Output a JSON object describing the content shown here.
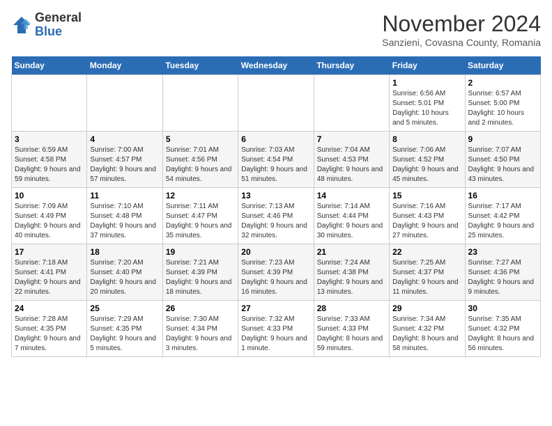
{
  "logo": {
    "text_general": "General",
    "text_blue": "Blue"
  },
  "header": {
    "title": "November 2024",
    "subtitle": "Sanzieni, Covasna County, Romania"
  },
  "weekdays": [
    "Sunday",
    "Monday",
    "Tuesday",
    "Wednesday",
    "Thursday",
    "Friday",
    "Saturday"
  ],
  "weeks": [
    [
      {
        "day": "",
        "sunrise": "",
        "sunset": "",
        "daylight": ""
      },
      {
        "day": "",
        "sunrise": "",
        "sunset": "",
        "daylight": ""
      },
      {
        "day": "",
        "sunrise": "",
        "sunset": "",
        "daylight": ""
      },
      {
        "day": "",
        "sunrise": "",
        "sunset": "",
        "daylight": ""
      },
      {
        "day": "",
        "sunrise": "",
        "sunset": "",
        "daylight": ""
      },
      {
        "day": "1",
        "sunrise": "Sunrise: 6:56 AM",
        "sunset": "Sunset: 5:01 PM",
        "daylight": "Daylight: 10 hours and 5 minutes."
      },
      {
        "day": "2",
        "sunrise": "Sunrise: 6:57 AM",
        "sunset": "Sunset: 5:00 PM",
        "daylight": "Daylight: 10 hours and 2 minutes."
      }
    ],
    [
      {
        "day": "3",
        "sunrise": "Sunrise: 6:59 AM",
        "sunset": "Sunset: 4:58 PM",
        "daylight": "Daylight: 9 hours and 59 minutes."
      },
      {
        "day": "4",
        "sunrise": "Sunrise: 7:00 AM",
        "sunset": "Sunset: 4:57 PM",
        "daylight": "Daylight: 9 hours and 57 minutes."
      },
      {
        "day": "5",
        "sunrise": "Sunrise: 7:01 AM",
        "sunset": "Sunset: 4:56 PM",
        "daylight": "Daylight: 9 hours and 54 minutes."
      },
      {
        "day": "6",
        "sunrise": "Sunrise: 7:03 AM",
        "sunset": "Sunset: 4:54 PM",
        "daylight": "Daylight: 9 hours and 51 minutes."
      },
      {
        "day": "7",
        "sunrise": "Sunrise: 7:04 AM",
        "sunset": "Sunset: 4:53 PM",
        "daylight": "Daylight: 9 hours and 48 minutes."
      },
      {
        "day": "8",
        "sunrise": "Sunrise: 7:06 AM",
        "sunset": "Sunset: 4:52 PM",
        "daylight": "Daylight: 9 hours and 45 minutes."
      },
      {
        "day": "9",
        "sunrise": "Sunrise: 7:07 AM",
        "sunset": "Sunset: 4:50 PM",
        "daylight": "Daylight: 9 hours and 43 minutes."
      }
    ],
    [
      {
        "day": "10",
        "sunrise": "Sunrise: 7:09 AM",
        "sunset": "Sunset: 4:49 PM",
        "daylight": "Daylight: 9 hours and 40 minutes."
      },
      {
        "day": "11",
        "sunrise": "Sunrise: 7:10 AM",
        "sunset": "Sunset: 4:48 PM",
        "daylight": "Daylight: 9 hours and 37 minutes."
      },
      {
        "day": "12",
        "sunrise": "Sunrise: 7:11 AM",
        "sunset": "Sunset: 4:47 PM",
        "daylight": "Daylight: 9 hours and 35 minutes."
      },
      {
        "day": "13",
        "sunrise": "Sunrise: 7:13 AM",
        "sunset": "Sunset: 4:46 PM",
        "daylight": "Daylight: 9 hours and 32 minutes."
      },
      {
        "day": "14",
        "sunrise": "Sunrise: 7:14 AM",
        "sunset": "Sunset: 4:44 PM",
        "daylight": "Daylight: 9 hours and 30 minutes."
      },
      {
        "day": "15",
        "sunrise": "Sunrise: 7:16 AM",
        "sunset": "Sunset: 4:43 PM",
        "daylight": "Daylight: 9 hours and 27 minutes."
      },
      {
        "day": "16",
        "sunrise": "Sunrise: 7:17 AM",
        "sunset": "Sunset: 4:42 PM",
        "daylight": "Daylight: 9 hours and 25 minutes."
      }
    ],
    [
      {
        "day": "17",
        "sunrise": "Sunrise: 7:18 AM",
        "sunset": "Sunset: 4:41 PM",
        "daylight": "Daylight: 9 hours and 22 minutes."
      },
      {
        "day": "18",
        "sunrise": "Sunrise: 7:20 AM",
        "sunset": "Sunset: 4:40 PM",
        "daylight": "Daylight: 9 hours and 20 minutes."
      },
      {
        "day": "19",
        "sunrise": "Sunrise: 7:21 AM",
        "sunset": "Sunset: 4:39 PM",
        "daylight": "Daylight: 9 hours and 18 minutes."
      },
      {
        "day": "20",
        "sunrise": "Sunrise: 7:23 AM",
        "sunset": "Sunset: 4:39 PM",
        "daylight": "Daylight: 9 hours and 16 minutes."
      },
      {
        "day": "21",
        "sunrise": "Sunrise: 7:24 AM",
        "sunset": "Sunset: 4:38 PM",
        "daylight": "Daylight: 9 hours and 13 minutes."
      },
      {
        "day": "22",
        "sunrise": "Sunrise: 7:25 AM",
        "sunset": "Sunset: 4:37 PM",
        "daylight": "Daylight: 9 hours and 11 minutes."
      },
      {
        "day": "23",
        "sunrise": "Sunrise: 7:27 AM",
        "sunset": "Sunset: 4:36 PM",
        "daylight": "Daylight: 9 hours and 9 minutes."
      }
    ],
    [
      {
        "day": "24",
        "sunrise": "Sunrise: 7:28 AM",
        "sunset": "Sunset: 4:35 PM",
        "daylight": "Daylight: 9 hours and 7 minutes."
      },
      {
        "day": "25",
        "sunrise": "Sunrise: 7:29 AM",
        "sunset": "Sunset: 4:35 PM",
        "daylight": "Daylight: 9 hours and 5 minutes."
      },
      {
        "day": "26",
        "sunrise": "Sunrise: 7:30 AM",
        "sunset": "Sunset: 4:34 PM",
        "daylight": "Daylight: 9 hours and 3 minutes."
      },
      {
        "day": "27",
        "sunrise": "Sunrise: 7:32 AM",
        "sunset": "Sunset: 4:33 PM",
        "daylight": "Daylight: 9 hours and 1 minute."
      },
      {
        "day": "28",
        "sunrise": "Sunrise: 7:33 AM",
        "sunset": "Sunset: 4:33 PM",
        "daylight": "Daylight: 8 hours and 59 minutes."
      },
      {
        "day": "29",
        "sunrise": "Sunrise: 7:34 AM",
        "sunset": "Sunset: 4:32 PM",
        "daylight": "Daylight: 8 hours and 58 minutes."
      },
      {
        "day": "30",
        "sunrise": "Sunrise: 7:35 AM",
        "sunset": "Sunset: 4:32 PM",
        "daylight": "Daylight: 8 hours and 56 minutes."
      }
    ]
  ]
}
